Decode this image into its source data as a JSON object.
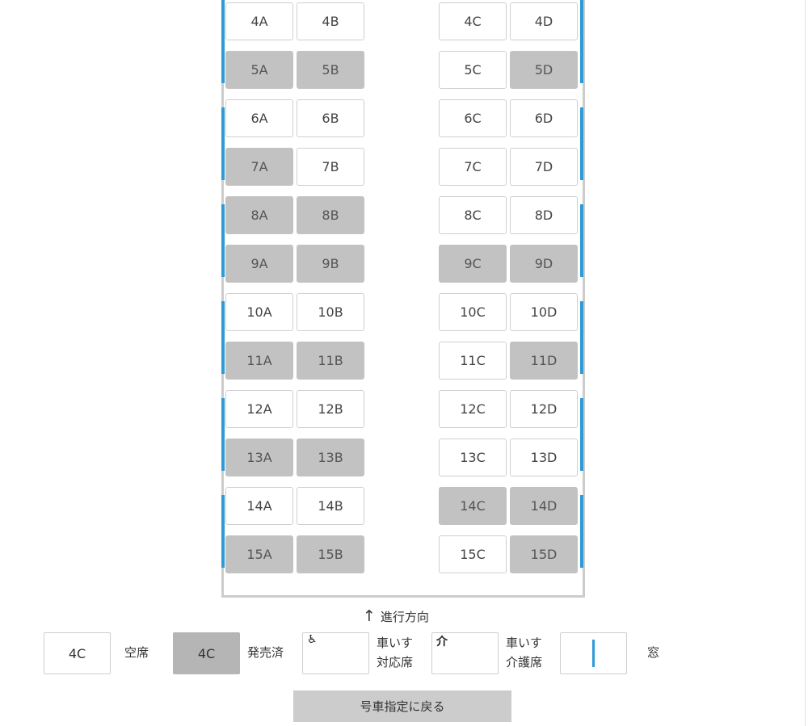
{
  "seat_rows": [
    {
      "row": "4",
      "seats": [
        {
          "label": "4A",
          "sold": false
        },
        {
          "label": "4B",
          "sold": false
        },
        {
          "label": "4C",
          "sold": false
        },
        {
          "label": "4D",
          "sold": false
        }
      ]
    },
    {
      "row": "5",
      "seats": [
        {
          "label": "5A",
          "sold": true
        },
        {
          "label": "5B",
          "sold": true
        },
        {
          "label": "5C",
          "sold": false
        },
        {
          "label": "5D",
          "sold": true
        }
      ]
    },
    {
      "row": "6",
      "seats": [
        {
          "label": "6A",
          "sold": false
        },
        {
          "label": "6B",
          "sold": false
        },
        {
          "label": "6C",
          "sold": false
        },
        {
          "label": "6D",
          "sold": false
        }
      ]
    },
    {
      "row": "7",
      "seats": [
        {
          "label": "7A",
          "sold": true
        },
        {
          "label": "7B",
          "sold": false
        },
        {
          "label": "7C",
          "sold": false
        },
        {
          "label": "7D",
          "sold": false
        }
      ]
    },
    {
      "row": "8",
      "seats": [
        {
          "label": "8A",
          "sold": true
        },
        {
          "label": "8B",
          "sold": true
        },
        {
          "label": "8C",
          "sold": false
        },
        {
          "label": "8D",
          "sold": false
        }
      ]
    },
    {
      "row": "9",
      "seats": [
        {
          "label": "9A",
          "sold": true
        },
        {
          "label": "9B",
          "sold": true
        },
        {
          "label": "9C",
          "sold": true
        },
        {
          "label": "9D",
          "sold": true
        }
      ]
    },
    {
      "row": "10",
      "seats": [
        {
          "label": "10A",
          "sold": false
        },
        {
          "label": "10B",
          "sold": false
        },
        {
          "label": "10C",
          "sold": false
        },
        {
          "label": "10D",
          "sold": false
        }
      ]
    },
    {
      "row": "11",
      "seats": [
        {
          "label": "11A",
          "sold": true
        },
        {
          "label": "11B",
          "sold": true
        },
        {
          "label": "11C",
          "sold": false
        },
        {
          "label": "11D",
          "sold": true
        }
      ]
    },
    {
      "row": "12",
      "seats": [
        {
          "label": "12A",
          "sold": false
        },
        {
          "label": "12B",
          "sold": false
        },
        {
          "label": "12C",
          "sold": false
        },
        {
          "label": "12D",
          "sold": false
        }
      ]
    },
    {
      "row": "13",
      "seats": [
        {
          "label": "13A",
          "sold": true
        },
        {
          "label": "13B",
          "sold": true
        },
        {
          "label": "13C",
          "sold": false
        },
        {
          "label": "13D",
          "sold": false
        }
      ]
    },
    {
      "row": "14",
      "seats": [
        {
          "label": "14A",
          "sold": false
        },
        {
          "label": "14B",
          "sold": false
        },
        {
          "label": "14C",
          "sold": true
        },
        {
          "label": "14D",
          "sold": true
        }
      ]
    },
    {
      "row": "15",
      "seats": [
        {
          "label": "15A",
          "sold": true
        },
        {
          "label": "15B",
          "sold": true
        },
        {
          "label": "15C",
          "sold": false
        },
        {
          "label": "15D",
          "sold": true
        }
      ]
    }
  ],
  "direction": {
    "arrow": "↑",
    "text": "進行方向"
  },
  "legend": {
    "available": {
      "seat": "4C",
      "label": "空席"
    },
    "sold": {
      "seat": "4C",
      "label": "発売済"
    },
    "wheelchair": {
      "icon": "♿",
      "line1": "車いす",
      "line2": "対応席"
    },
    "caregiver": {
      "icon": "介",
      "line1": "車いす",
      "line2": "介護席"
    },
    "window": {
      "label": "窓"
    }
  },
  "back_button": {
    "label": "号車指定に戻る"
  },
  "colors": {
    "window": "#2e9ad6",
    "sold": "#c2c2c2",
    "frame": "#cccccc"
  }
}
